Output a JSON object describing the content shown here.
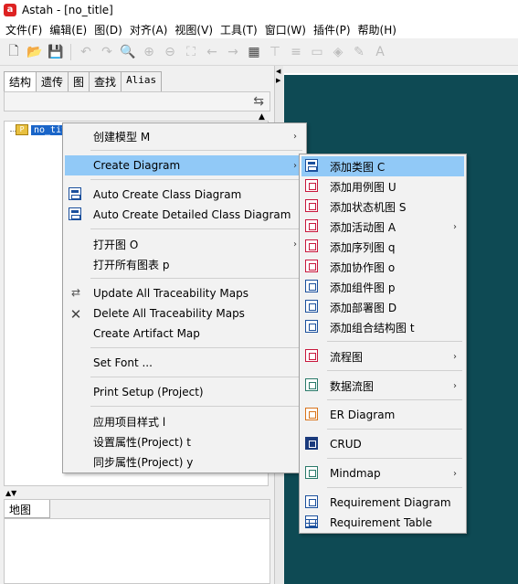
{
  "window": {
    "title": "Astah - [no_title]",
    "app_icon": "astah-logo"
  },
  "menubar": [
    "文件(F)",
    "编辑(E)",
    "图(D)",
    "对齐(A)",
    "视图(V)",
    "工具(T)",
    "窗口(W)",
    "插件(P)",
    "帮助(H)"
  ],
  "toolbar": {
    "icons": [
      "new-file-icon",
      "open-folder-icon",
      "save-icon",
      "undo-icon",
      "redo-icon",
      "zoom-icon",
      "zoom-in-icon",
      "zoom-out-icon",
      "fit-icon",
      "back-icon",
      "forward-icon",
      "qrcode-icon",
      "align-icon",
      "distribute-icon",
      "layer-icon",
      "fill-color-icon",
      "line-color-icon",
      "font-color-icon"
    ]
  },
  "left_panel": {
    "tabs": [
      "结构",
      "遗传",
      "图",
      "查找",
      "Alias"
    ],
    "active_tab": "结构",
    "tree_root": "no_title",
    "map_tab": "地图"
  },
  "context_menu": {
    "items": [
      {
        "label": "创建模型 M",
        "submenu": true
      },
      {
        "label": "Create Diagram",
        "submenu": true,
        "highlighted": true
      },
      {
        "label": "Auto Create Class Diagram",
        "icon": "class-diagram-icon"
      },
      {
        "label": "Auto Create Detailed Class Diagram",
        "icon": "class-diagram-icon"
      },
      {
        "label": "打开图 O",
        "submenu": true
      },
      {
        "label": "打开所有图表 p"
      },
      {
        "label": "Update All Traceability Maps",
        "icon": "traceability-update-icon"
      },
      {
        "label": "Delete All Traceability Maps",
        "icon": "traceability-delete-icon"
      },
      {
        "label": "Create Artifact Map"
      },
      {
        "label": "Set Font ..."
      },
      {
        "label": "Print Setup (Project)"
      },
      {
        "label": "应用项目样式 l"
      },
      {
        "label": "设置属性(Project) t"
      },
      {
        "label": "同步属性(Project) y"
      }
    ]
  },
  "create_diagram_submenu": {
    "items": [
      {
        "label": "添加类图 C",
        "icon": "class-diagram-icon",
        "highlighted": true
      },
      {
        "label": "添加用例图 U",
        "icon": "usecase-diagram-icon"
      },
      {
        "label": "添加状态机图 S",
        "icon": "statemachine-diagram-icon"
      },
      {
        "label": "添加活动图 A",
        "icon": "activity-diagram-icon",
        "submenu": true
      },
      {
        "label": "添加序列图 q",
        "icon": "sequence-diagram-icon"
      },
      {
        "label": "添加协作图 o",
        "icon": "communication-diagram-icon"
      },
      {
        "label": "添加组件图 p",
        "icon": "component-diagram-icon"
      },
      {
        "label": "添加部署图 D",
        "icon": "deployment-diagram-icon"
      },
      {
        "label": "添加组合结构图 t",
        "icon": "composite-structure-icon"
      },
      {
        "label": "流程图",
        "icon": "flowchart-icon",
        "submenu": true
      },
      {
        "label": "数据流图",
        "icon": "dataflow-diagram-icon",
        "submenu": true
      },
      {
        "label": "ER Diagram",
        "icon": "er-diagram-icon"
      },
      {
        "label": "CRUD",
        "icon": "crud-icon"
      },
      {
        "label": "Mindmap",
        "icon": "mindmap-icon",
        "submenu": true
      },
      {
        "label": "Requirement Diagram",
        "icon": "requirement-diagram-icon"
      },
      {
        "label": "Requirement Table",
        "icon": "requirement-table-icon"
      }
    ]
  },
  "colors": {
    "highlight": "#91c9f7",
    "canvas": "#0e4a54",
    "selection": "#1a65c8"
  }
}
